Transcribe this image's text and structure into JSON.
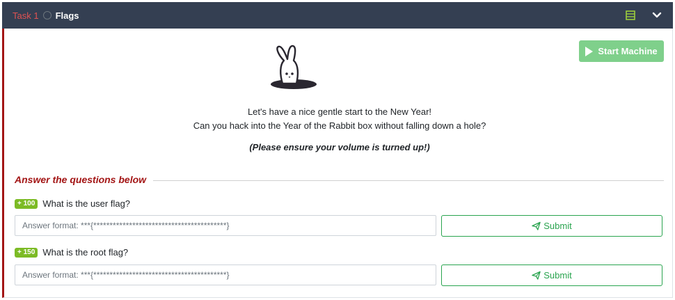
{
  "header": {
    "task_number": "Task 1",
    "task_title": "Flags",
    "icons": [
      "list-icon",
      "chevron-down-icon"
    ]
  },
  "machine": {
    "start_label": "Start Machine",
    "accent": "#7fd08b"
  },
  "intro": {
    "line1": "Let's have a nice gentle start to the New Year!",
    "line2": "Can you hack into the Year of the Rabbit box without falling down a hole?",
    "note": "(Please ensure your volume is turned up!)"
  },
  "answers": {
    "heading": "Answer the questions below",
    "questions": [
      {
        "points": "+ 100",
        "text": "What is the user flag?",
        "placeholder": "Answer format: ***{*****************************************}",
        "submit_label": "Submit"
      },
      {
        "points": "+ 150",
        "text": "What is the root flag?",
        "placeholder": "Answer format: ***{*****************************************}",
        "submit_label": "Submit"
      }
    ]
  },
  "colors": {
    "header_bg": "#343f52",
    "accent_red": "#a31515",
    "badge_green": "#7cbb25",
    "submit_green": "#2aa44f"
  }
}
